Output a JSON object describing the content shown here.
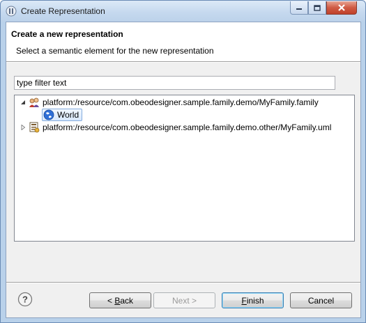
{
  "window": {
    "title": "Create Representation",
    "minimize_icon": "minimize-icon",
    "maximize_icon": "maximize-icon",
    "close_icon": "close-icon"
  },
  "header": {
    "title": "Create a new representation",
    "description": "Select a semantic element for the new representation"
  },
  "filter": {
    "value": "type filter text"
  },
  "tree": {
    "items": [
      {
        "label": "platform:/resource/com.obeodesigner.sample.family.demo/MyFamily.family",
        "icon": "family-model-icon",
        "expanded": true,
        "children": [
          {
            "label": "World",
            "icon": "world-element-icon",
            "selected": true
          }
        ]
      },
      {
        "label": "platform:/resource/com.obeodesigner.sample.family.demo.other/MyFamily.uml",
        "icon": "uml-model-icon",
        "expanded": false
      }
    ]
  },
  "buttons": {
    "back_prefix": "< ",
    "back_mnemonic": "B",
    "back_rest": "ack",
    "next": "Next >",
    "finish_mnemonic": "F",
    "finish_rest": "inish",
    "cancel": "Cancel"
  },
  "colors": {
    "titlebar": "#c4d8ee",
    "dialog_bg": "#f0f0f0",
    "selection": "#d8e8fc",
    "close_button": "#c0402a"
  }
}
